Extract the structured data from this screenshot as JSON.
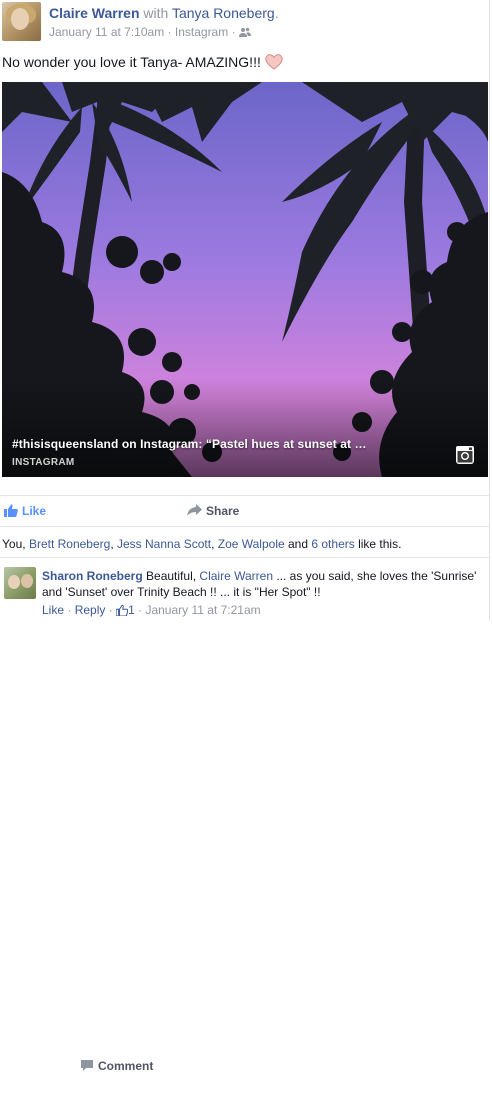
{
  "post": {
    "author": "Claire Warren",
    "with_text": "with",
    "tagged": "Tanya Roneberg",
    "period": ".",
    "date": "January 11 at 7:10am",
    "separator": "·",
    "via": "Instagram",
    "audience_icon": "friends-icon",
    "status_text": "No wonder you love it Tanya- AMAZING!!!",
    "emoji": "heart-icon"
  },
  "photo": {
    "caption": "#thisisqueensland on Instagram: “Pastel hues at sunset at …",
    "source": "INSTAGRAM",
    "icon": "instagram-icon"
  },
  "actions": {
    "like": "Like",
    "comment": "Comment",
    "share": "Share"
  },
  "likes": {
    "prefix": "You,",
    "names": [
      "Brett Roneberg",
      "Jess Nanna Scott",
      "Zoe Walpole"
    ],
    "and": "and",
    "others": "6 others",
    "suffix": "like this."
  },
  "comment": {
    "author": "Sharon Roneberg",
    "text_before": "Beautiful,",
    "mention": "Claire Warren",
    "text_after": "... as you said, she loves the 'Sunrise' and 'Sunset' over Trinity Beach !! ... it is \"Her Spot\" !!",
    "like_link": "Like",
    "reply_link": "Reply",
    "like_count": "1",
    "date": "January 11 at 7:21am"
  },
  "colors": {
    "link": "#3b5998",
    "meta": "#9197a3",
    "like_accent": "#5890ff",
    "sky_top": "#7a6fd0",
    "sky_bottom": "#d77fd8"
  }
}
